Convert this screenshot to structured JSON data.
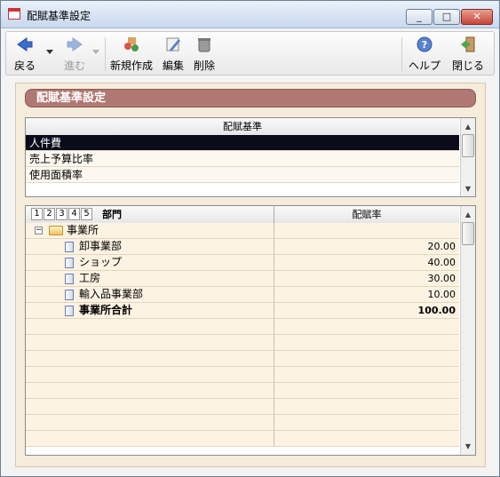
{
  "window": {
    "title": "配賦基準設定"
  },
  "toolbar": {
    "back": "戻る",
    "forward": "進む",
    "new": "新規作成",
    "edit": "編集",
    "delete": "削除",
    "help": "ヘルプ",
    "close": "閉じる"
  },
  "section": {
    "title": "配賦基準設定"
  },
  "basis_list": {
    "header": "配賦基準",
    "items": [
      "人件費",
      "売上予算比率",
      "使用面積率"
    ],
    "selected_index": 0
  },
  "grid": {
    "levels": [
      "1",
      "2",
      "3",
      "4",
      "5"
    ],
    "col_dept": "部門",
    "col_rate": "配賦率",
    "rows": [
      {
        "name": "事業所",
        "rate": ""
      },
      {
        "name": "卸事業部",
        "rate": "20.00"
      },
      {
        "name": "ショップ",
        "rate": "40.00"
      },
      {
        "name": "工房",
        "rate": "30.00"
      },
      {
        "name": "輸入品事業部",
        "rate": "10.00"
      },
      {
        "name": "事業所合計",
        "rate": "100.00"
      }
    ]
  },
  "icons": {
    "back": "back-arrow-icon",
    "forward": "forward-arrow-icon",
    "new": "new-document-icon",
    "edit": "edit-icon",
    "delete": "trash-icon",
    "help": "help-icon",
    "close": "exit-door-icon",
    "app": "calendar-icon"
  },
  "colors": {
    "accent": "#b07872",
    "selection": "#0a0a1a",
    "panel": "#f6ecdc"
  }
}
